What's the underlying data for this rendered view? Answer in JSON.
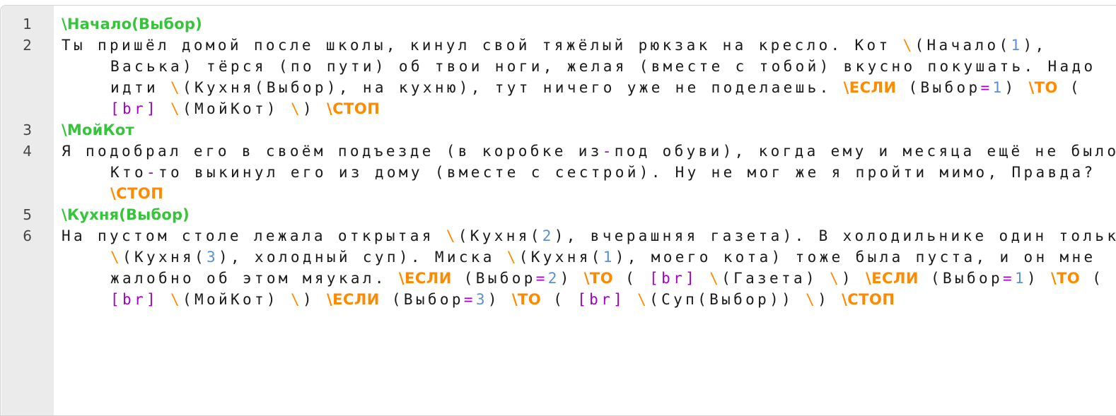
{
  "editor": {
    "lines": [
      {
        "number": "1",
        "tokens": [
          {
            "type": "label",
            "text": "\\Начало(Выбор)"
          }
        ]
      },
      {
        "number": "2",
        "tokens": [
          {
            "type": "text",
            "text": "Ты пришёл домой после школы, кинул свой тяжёлый рюкзак на кресло. Кот "
          },
          {
            "type": "bs",
            "text": "\\"
          },
          {
            "type": "text",
            "text": "(Начало("
          },
          {
            "type": "num",
            "text": "1"
          },
          {
            "type": "text",
            "text": "), Васька) тёрся (по пути) об твои ноги, желая (вместе с тобой) вкусно покушать. Надо идти "
          },
          {
            "type": "bs",
            "text": "\\"
          },
          {
            "type": "text",
            "text": "(Кухня(Выбор), на кухню), тут ничего уже не поделаешь. "
          },
          {
            "type": "kw",
            "text": "\\ЕСЛИ"
          },
          {
            "type": "text",
            "text": " (Выбор"
          },
          {
            "type": "op",
            "text": "="
          },
          {
            "type": "num",
            "text": "1"
          },
          {
            "type": "text",
            "text": ") "
          },
          {
            "type": "kw",
            "text": "\\ТО"
          },
          {
            "type": "text",
            "text": " ( "
          },
          {
            "type": "tag",
            "text": "[br]"
          },
          {
            "type": "text",
            "text": " "
          },
          {
            "type": "bs",
            "text": "\\"
          },
          {
            "type": "text",
            "text": "(МойКот) "
          },
          {
            "type": "bs",
            "text": "\\"
          },
          {
            "type": "text",
            "text": ") "
          },
          {
            "type": "kw",
            "text": "\\СТОП"
          }
        ]
      },
      {
        "number": "3",
        "tokens": [
          {
            "type": "label",
            "text": "\\МойКот"
          }
        ]
      },
      {
        "number": "4",
        "tokens": [
          {
            "type": "text",
            "text": "Я подобрал его в своём подъезде (в коробке из"
          },
          {
            "type": "op",
            "text": "-"
          },
          {
            "type": "text",
            "text": "под обуви), когда ему и месяца ещё не было. Кто"
          },
          {
            "type": "op",
            "text": "-"
          },
          {
            "type": "text",
            "text": "то выкинул его из дому (вместе с сестрой). Ну не мог же я пройти мимо, Правда? "
          },
          {
            "type": "kw",
            "text": "\\СТОП"
          }
        ]
      },
      {
        "number": "5",
        "tokens": [
          {
            "type": "label",
            "text": "\\Кухня(Выбор)"
          }
        ]
      },
      {
        "number": "6",
        "tokens": [
          {
            "type": "text",
            "text": "На пустом столе лежала открытая "
          },
          {
            "type": "bs",
            "text": "\\"
          },
          {
            "type": "text",
            "text": "(Кухня("
          },
          {
            "type": "num",
            "text": "2"
          },
          {
            "type": "text",
            "text": "), вчерашняя газета). В холодильнике один только "
          },
          {
            "type": "bs",
            "text": "\\"
          },
          {
            "type": "text",
            "text": "(Кухня("
          },
          {
            "type": "num",
            "text": "3"
          },
          {
            "type": "text",
            "text": "), холодный суп). Миска "
          },
          {
            "type": "bs",
            "text": "\\"
          },
          {
            "type": "text",
            "text": "(Кухня("
          },
          {
            "type": "num",
            "text": "1"
          },
          {
            "type": "text",
            "text": "), моего кота) тоже была пуста, и он мне жалобно об этом мяукал. "
          },
          {
            "type": "kw",
            "text": "\\ЕСЛИ"
          },
          {
            "type": "text",
            "text": " (Выбор"
          },
          {
            "type": "op",
            "text": "="
          },
          {
            "type": "num",
            "text": "2"
          },
          {
            "type": "text",
            "text": ") "
          },
          {
            "type": "kw",
            "text": "\\ТО"
          },
          {
            "type": "text",
            "text": " ( "
          },
          {
            "type": "tag",
            "text": "[br]"
          },
          {
            "type": "text",
            "text": " "
          },
          {
            "type": "bs",
            "text": "\\"
          },
          {
            "type": "text",
            "text": "(Газета) "
          },
          {
            "type": "bs",
            "text": "\\"
          },
          {
            "type": "text",
            "text": ") "
          },
          {
            "type": "kw",
            "text": "\\ЕСЛИ"
          },
          {
            "type": "text",
            "text": " (Выбор"
          },
          {
            "type": "op",
            "text": "="
          },
          {
            "type": "num",
            "text": "1"
          },
          {
            "type": "text",
            "text": ") "
          },
          {
            "type": "kw",
            "text": "\\ТО"
          },
          {
            "type": "text",
            "text": " ( "
          },
          {
            "type": "tag",
            "text": "[br]"
          },
          {
            "type": "text",
            "text": " "
          },
          {
            "type": "bs",
            "text": "\\"
          },
          {
            "type": "text",
            "text": "(МойКот) "
          },
          {
            "type": "bs",
            "text": "\\"
          },
          {
            "type": "text",
            "text": ") "
          },
          {
            "type": "kw",
            "text": "\\ЕСЛИ"
          },
          {
            "type": "text",
            "text": " (Выбор"
          },
          {
            "type": "op",
            "text": "="
          },
          {
            "type": "num",
            "text": "3"
          },
          {
            "type": "text",
            "text": ") "
          },
          {
            "type": "kw",
            "text": "\\ТО"
          },
          {
            "type": "text",
            "text": " ( "
          },
          {
            "type": "tag",
            "text": "[br]"
          },
          {
            "type": "text",
            "text": " "
          },
          {
            "type": "bs",
            "text": "\\"
          },
          {
            "type": "text",
            "text": "(Суп(Выбор)) "
          },
          {
            "type": "bs",
            "text": "\\"
          },
          {
            "type": "text",
            "text": ") "
          },
          {
            "type": "kw",
            "text": "\\СТОП"
          }
        ]
      }
    ]
  },
  "colors": {
    "label": "#36c43a",
    "keyword": "#ff8a00",
    "number": "#5a8fd4",
    "operator": "#a300c9",
    "tag": "#a300c9",
    "text": "#1a1a1a",
    "gutter_bg": "#ebebeb",
    "line_number": "#444444"
  }
}
